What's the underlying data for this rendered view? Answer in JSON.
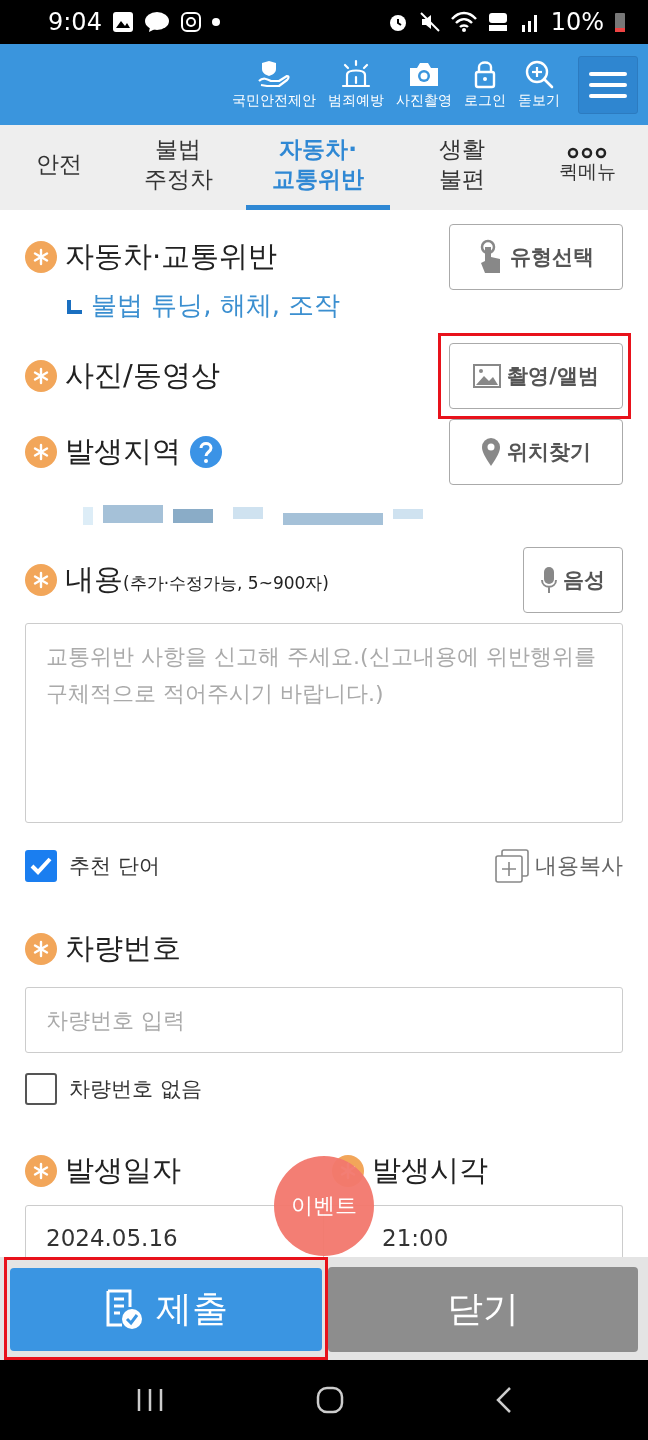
{
  "status_bar": {
    "time": "9:04",
    "battery": "10%"
  },
  "header": {
    "items": [
      {
        "kind": "safety",
        "label": "국민안전제안"
      },
      {
        "kind": "siren",
        "label": "범죄예방"
      },
      {
        "kind": "camera",
        "label": "사진촬영"
      },
      {
        "kind": "lock",
        "label": "로그인"
      },
      {
        "kind": "zoom",
        "label": "돋보기"
      }
    ]
  },
  "tabs": [
    {
      "label": "안전",
      "selected": false
    },
    {
      "label": "불법\n주정차",
      "selected": false
    },
    {
      "label": "자동차·\n교통위반",
      "selected": true
    },
    {
      "label": "생활\n불편",
      "selected": false
    },
    {
      "label": "퀵메뉴",
      "kind": "more",
      "selected": false
    }
  ],
  "form": {
    "category": {
      "label": "자동차·교통위반",
      "button": "유형선택",
      "sub": "불법 튜닝, 해체, 조작"
    },
    "media": {
      "label": "사진/동영상",
      "button": "촬영/앨범",
      "highlighted": true
    },
    "location": {
      "label": "발생지역",
      "button": "위치찾기",
      "address": {
        "kind": "redacted"
      }
    },
    "content": {
      "label": "내용",
      "hint": "(추가·수정가능, 5~900자)",
      "button": "음성",
      "placeholder": "교통위반 사항을 신고해 주세요.(신고내용에 위반행위를 구체적으로 적어주시기 바랍니다.)",
      "recommend": {
        "label": "추천 단어",
        "checked": true
      },
      "copy": "내용복사"
    },
    "vehicle": {
      "label": "차량번호",
      "placeholder": "차량번호 입력",
      "none": {
        "label": "차량번호 없음",
        "checked": false
      }
    },
    "date": {
      "label": "발생일자",
      "value": "2024.05.16"
    },
    "time": {
      "label": "발생시각",
      "value": "21:00"
    }
  },
  "event_badge": "이벤트",
  "actions": [
    {
      "kind": "submit",
      "label": "제출",
      "highlighted": true
    },
    {
      "kind": "close",
      "label": "닫기",
      "highlighted": false
    }
  ]
}
